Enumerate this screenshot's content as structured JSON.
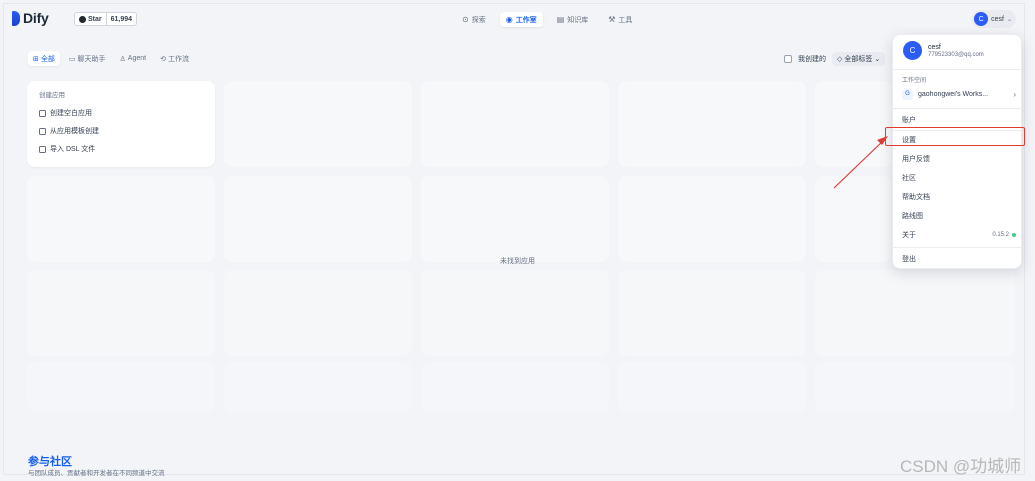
{
  "header": {
    "logo": "Dify",
    "github": {
      "star_label": "Star",
      "count": "61,994"
    },
    "nav": [
      {
        "label": "探索",
        "icon": "compass-icon",
        "active": false
      },
      {
        "label": "工作室",
        "icon": "robot-icon",
        "active": true
      },
      {
        "label": "知识库",
        "icon": "book-icon",
        "active": false
      },
      {
        "label": "工具",
        "icon": "tool-icon",
        "active": false
      }
    ],
    "user": {
      "initial": "C",
      "name": "cesf"
    }
  },
  "tabs": [
    {
      "label": "全部",
      "active": true
    },
    {
      "label": "聊天助手",
      "active": false
    },
    {
      "label": "Agent",
      "active": false
    },
    {
      "label": "工作流",
      "active": false
    }
  ],
  "filters": {
    "mine_label": "我创建的",
    "tag_label": "全部标签"
  },
  "new_app": {
    "title": "创建应用",
    "items": [
      "创建空白应用",
      "从应用模板创建",
      "导入 DSL 文件"
    ]
  },
  "empty_text": "未找到应用",
  "footer": {
    "title": "参与社区",
    "subtitle": "与团队成员、贡献者和开发者在不同频道中交流"
  },
  "menu": {
    "avatar_initial": "C",
    "name": "cesf",
    "email": "779523303@qq.com",
    "workspace_label": "工作空间",
    "workspace_initial": "G",
    "workspace_name": "gaohongwei's Works...",
    "items": {
      "account": "账户",
      "settings": "设置",
      "feedback": "用户反馈",
      "community": "社区",
      "docs": "帮助文档",
      "roadmap": "路线图",
      "about": "关于",
      "logout": "登出"
    },
    "version": "0.15.2"
  },
  "colors": {
    "accent": "#155eef",
    "highlight": "#e23b2e",
    "status_ok": "#47cd89"
  },
  "watermark": "CSDN @功城师"
}
